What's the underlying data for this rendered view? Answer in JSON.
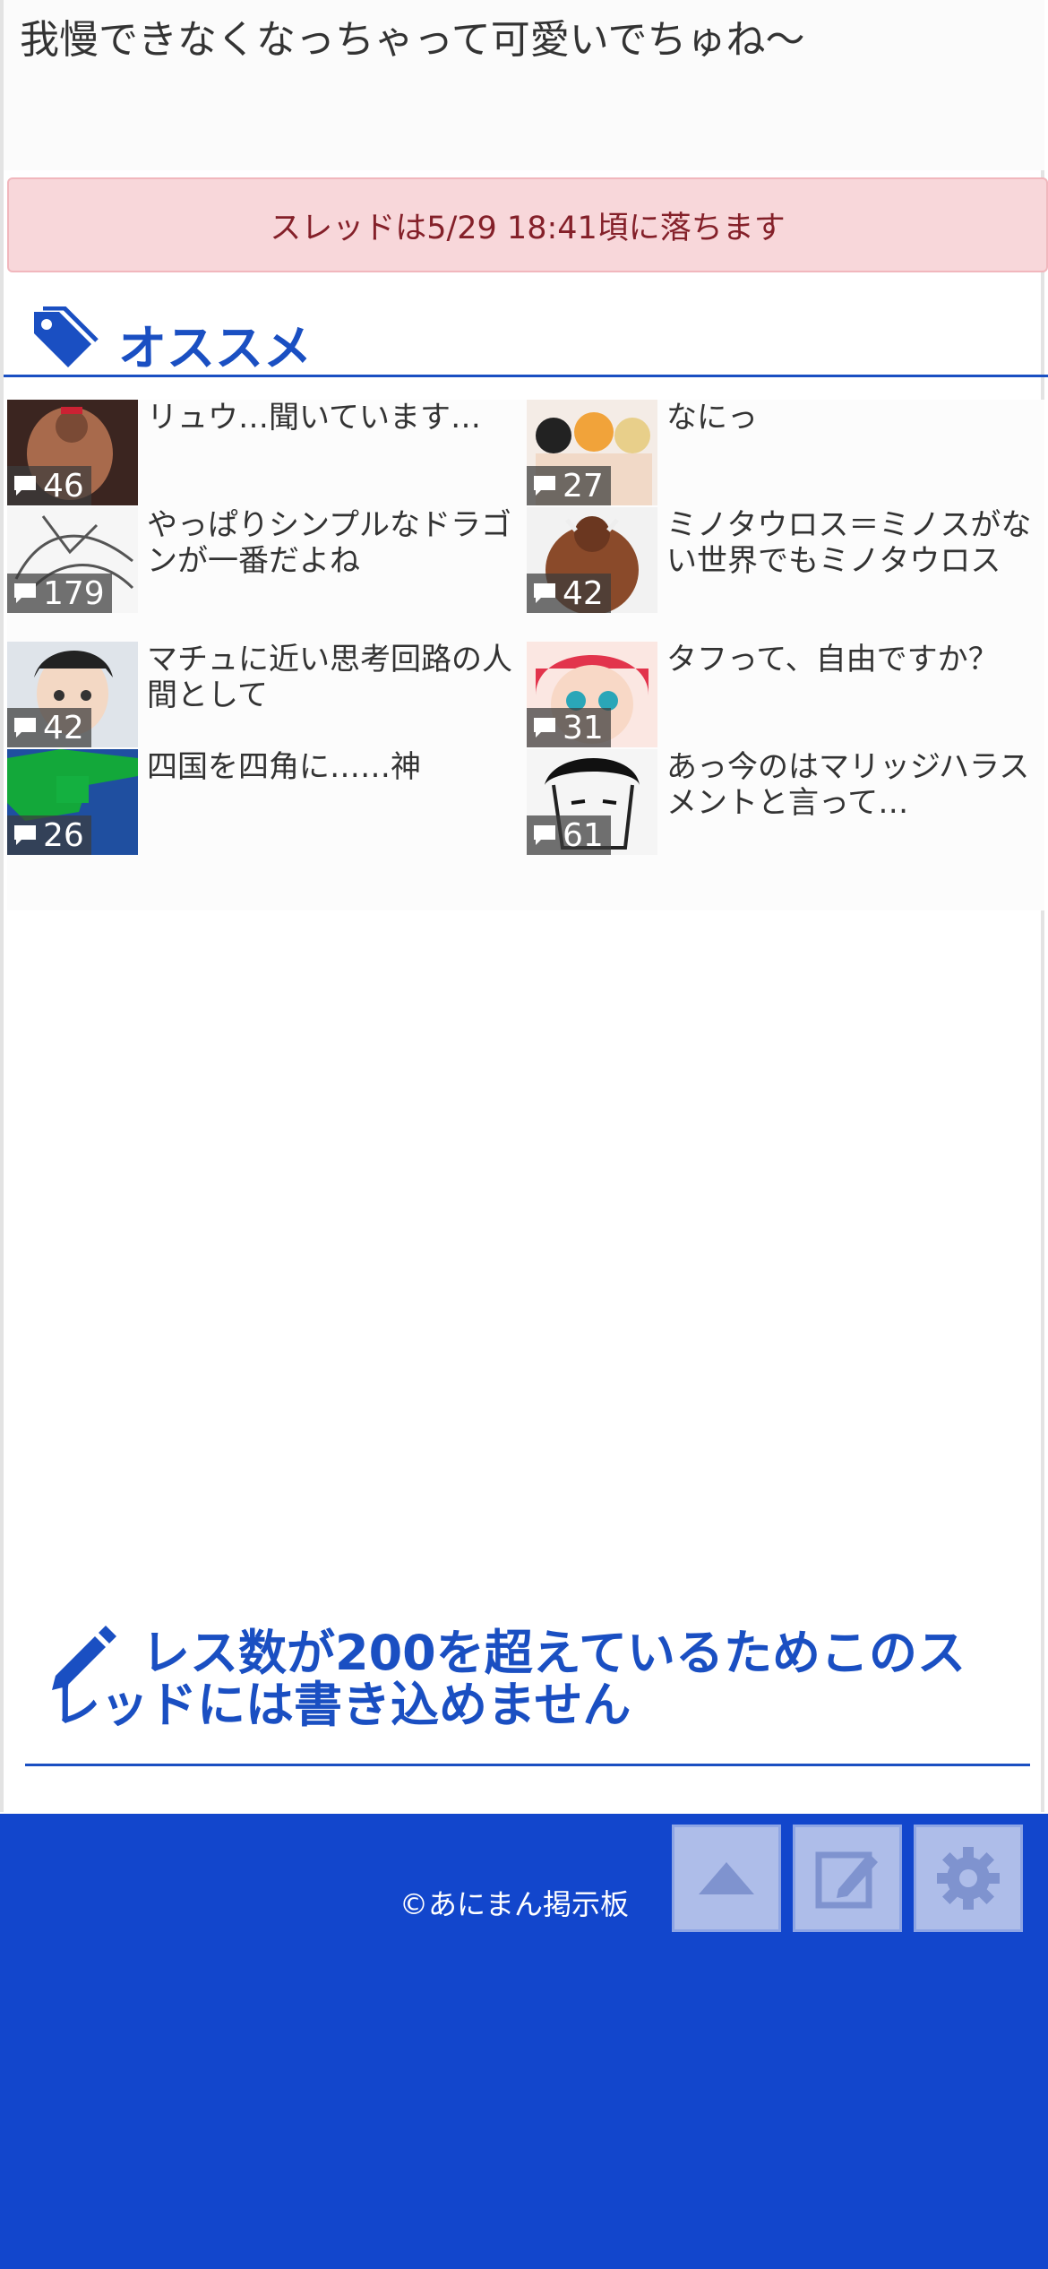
{
  "thread": {
    "last_post_text": "我慢できなくなっちゃって可愛いでちゅね〜",
    "alert": "スレッドは5/29 18:41頃に落ちます"
  },
  "recommend": {
    "title": "オススメ",
    "items": [
      {
        "title": "リュウ…聞いています…",
        "count": "46"
      },
      {
        "title": "なにっ",
        "count": "27"
      },
      {
        "title": "やっぱりシンプルなドラゴンが一番だよね",
        "count": "179"
      },
      {
        "title": "ミノタウロス＝ミノスがない世界でもミノタウロス",
        "count": "42"
      },
      {
        "title": "マチュに近い思考回路の人間として",
        "count": "42"
      },
      {
        "title": "タフって、自由ですか？",
        "count": "31"
      },
      {
        "title": "四国を四角に……神",
        "count": "26"
      },
      {
        "title": "あっ今のはマリッジハラスメントと言って…",
        "count": "61"
      }
    ]
  },
  "closed_message": "レス数が200を超えているためこのスレッドには書き込めません",
  "footer": {
    "copyright": "©あにまん掲示板",
    "buttons": [
      "scroll-top",
      "write",
      "settings"
    ]
  },
  "colors": {
    "accent": "#1a4fc2",
    "footer_bg": "#1246cc",
    "alert_bg": "#f8d7da",
    "alert_text": "#842029"
  }
}
